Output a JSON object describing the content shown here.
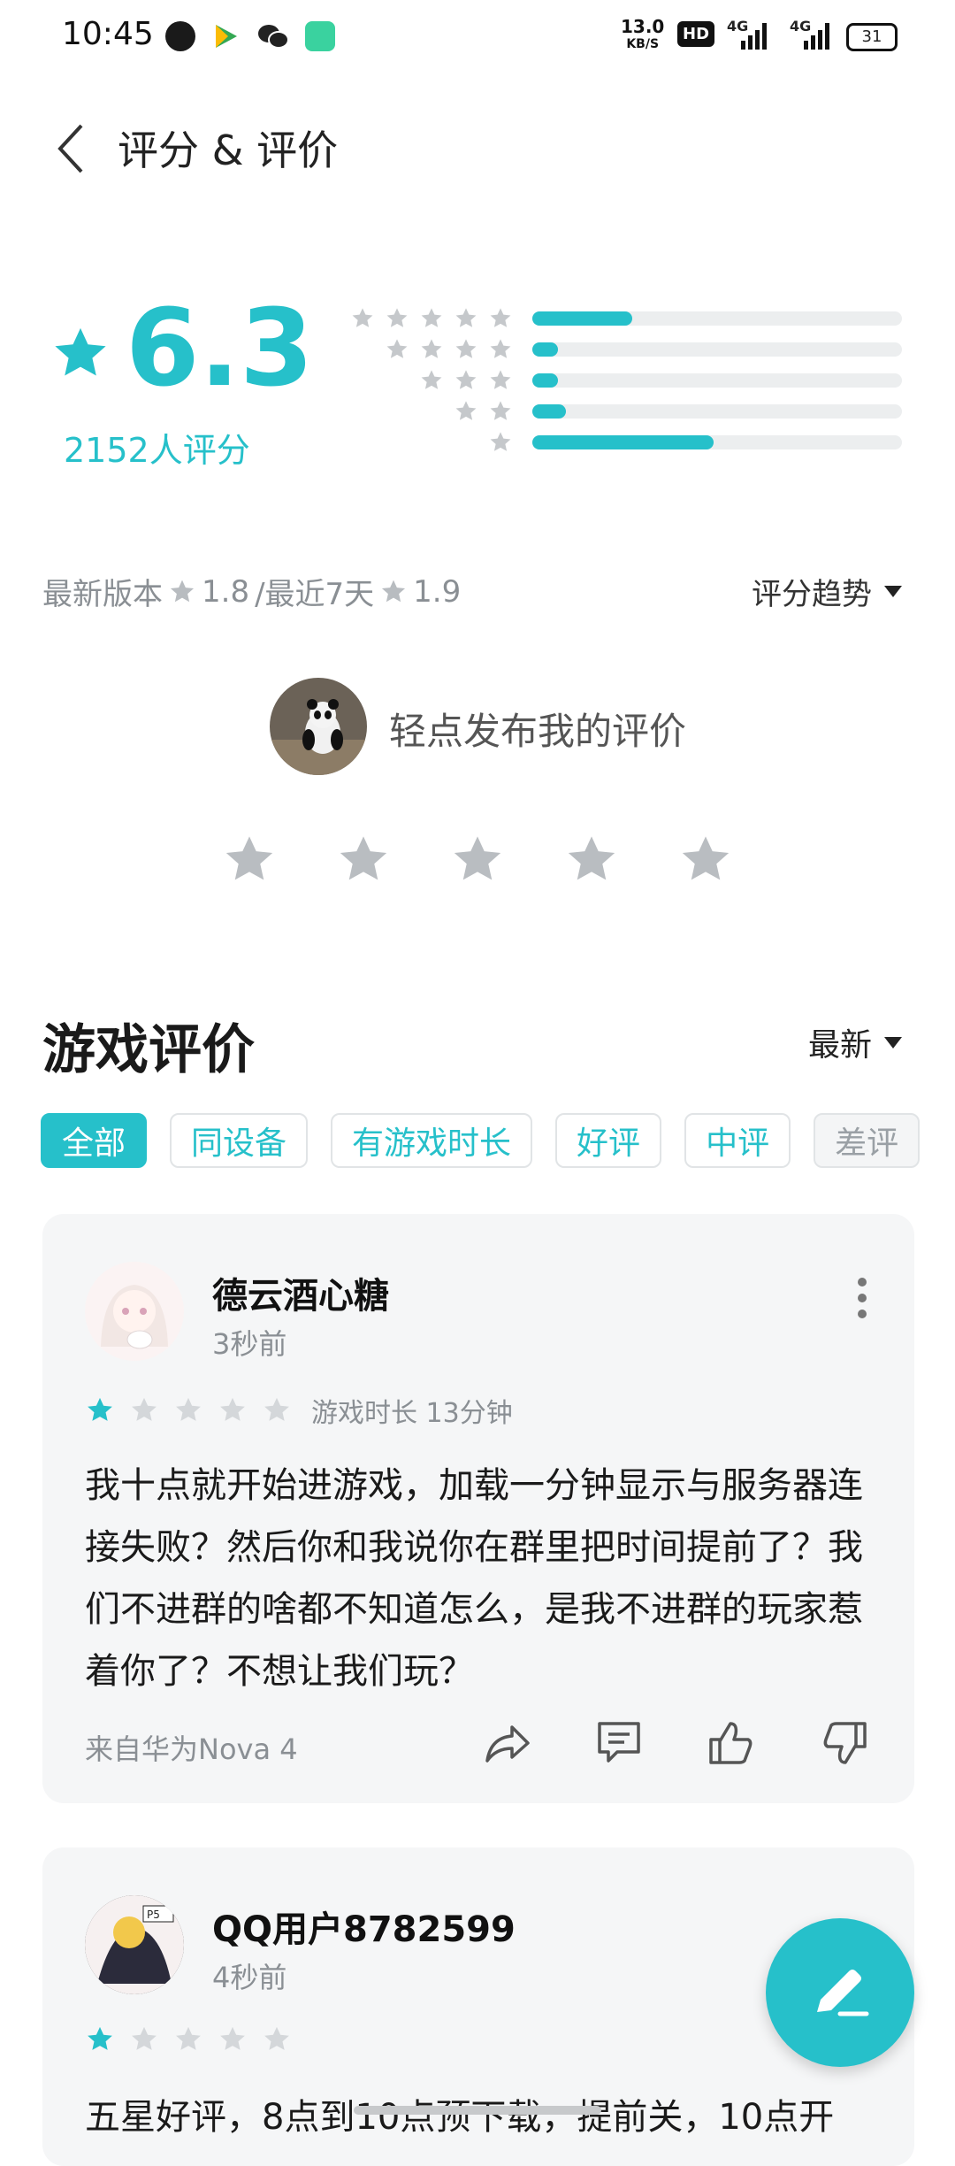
{
  "status_bar": {
    "time": "10:45",
    "speed_top": "13.0",
    "speed_unit": "KB/S",
    "hd": "HD",
    "net1": "4G",
    "net2": "4G",
    "battery": "31"
  },
  "header": {
    "title": "评分 & 评价",
    "back_icon": "chevron-left-icon"
  },
  "rating": {
    "score": "6.3",
    "count": "2152人评分",
    "distribution": [
      {
        "stars": 5,
        "fraction": 0.27
      },
      {
        "stars": 4,
        "fraction": 0.07
      },
      {
        "stars": 3,
        "fraction": 0.07
      },
      {
        "stars": 2,
        "fraction": 0.09
      },
      {
        "stars": 1,
        "fraction": 0.49
      }
    ]
  },
  "version": {
    "latest_label": "最新版本",
    "latest_value": "1.8",
    "recent_label": "/最近7天",
    "recent_value": "1.9",
    "trend_label": "评分趋势"
  },
  "my_review": {
    "prompt": "轻点发布我的评价"
  },
  "reviews_section": {
    "title": "游戏评价",
    "sort": "最新",
    "filters": [
      "全部",
      "同设备",
      "有游戏时长",
      "好评",
      "中评",
      "差评"
    ]
  },
  "reviews": [
    {
      "name": "德云酒心糖",
      "time": "3秒前",
      "stars": 1,
      "playtime": "游戏时长 13分钟",
      "text": "我十点就开始进游戏，加载一分钟显示与服务器连接失败？然后你和我说你在群里把时间提前了？我们不进群的啥都不知道怎么，是我不进群的玩家惹着你了？不想让我们玩？",
      "device": "来自华为Nova 4"
    },
    {
      "name": "QQ用户8782599",
      "time": "4秒前",
      "stars": 1,
      "text": "五星好评，8点到10点预下载，提前关，10点开"
    }
  ],
  "colors": {
    "accent": "#26C0CA",
    "star_inactive": "#c5c8cb",
    "card_bg": "#f5f6f7"
  }
}
